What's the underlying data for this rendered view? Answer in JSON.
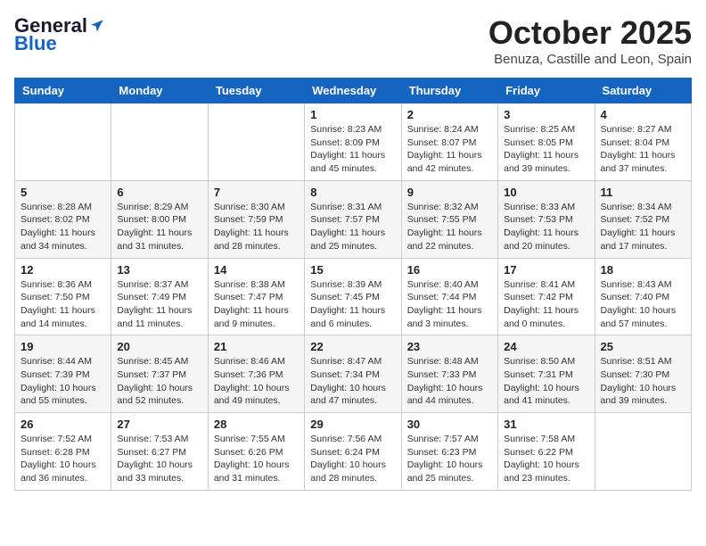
{
  "header": {
    "logo": {
      "general": "General",
      "blue": "Blue"
    },
    "title": "October 2025",
    "subtitle": "Benuza, Castille and Leon, Spain"
  },
  "weekdays": [
    "Sunday",
    "Monday",
    "Tuesday",
    "Wednesday",
    "Thursday",
    "Friday",
    "Saturday"
  ],
  "weeks": [
    [
      {
        "day": "",
        "info": ""
      },
      {
        "day": "",
        "info": ""
      },
      {
        "day": "",
        "info": ""
      },
      {
        "day": "1",
        "info": "Sunrise: 8:23 AM\nSunset: 8:09 PM\nDaylight: 11 hours and 45 minutes."
      },
      {
        "day": "2",
        "info": "Sunrise: 8:24 AM\nSunset: 8:07 PM\nDaylight: 11 hours and 42 minutes."
      },
      {
        "day": "3",
        "info": "Sunrise: 8:25 AM\nSunset: 8:05 PM\nDaylight: 11 hours and 39 minutes."
      },
      {
        "day": "4",
        "info": "Sunrise: 8:27 AM\nSunset: 8:04 PM\nDaylight: 11 hours and 37 minutes."
      }
    ],
    [
      {
        "day": "5",
        "info": "Sunrise: 8:28 AM\nSunset: 8:02 PM\nDaylight: 11 hours and 34 minutes."
      },
      {
        "day": "6",
        "info": "Sunrise: 8:29 AM\nSunset: 8:00 PM\nDaylight: 11 hours and 31 minutes."
      },
      {
        "day": "7",
        "info": "Sunrise: 8:30 AM\nSunset: 7:59 PM\nDaylight: 11 hours and 28 minutes."
      },
      {
        "day": "8",
        "info": "Sunrise: 8:31 AM\nSunset: 7:57 PM\nDaylight: 11 hours and 25 minutes."
      },
      {
        "day": "9",
        "info": "Sunrise: 8:32 AM\nSunset: 7:55 PM\nDaylight: 11 hours and 22 minutes."
      },
      {
        "day": "10",
        "info": "Sunrise: 8:33 AM\nSunset: 7:53 PM\nDaylight: 11 hours and 20 minutes."
      },
      {
        "day": "11",
        "info": "Sunrise: 8:34 AM\nSunset: 7:52 PM\nDaylight: 11 hours and 17 minutes."
      }
    ],
    [
      {
        "day": "12",
        "info": "Sunrise: 8:36 AM\nSunset: 7:50 PM\nDaylight: 11 hours and 14 minutes."
      },
      {
        "day": "13",
        "info": "Sunrise: 8:37 AM\nSunset: 7:49 PM\nDaylight: 11 hours and 11 minutes."
      },
      {
        "day": "14",
        "info": "Sunrise: 8:38 AM\nSunset: 7:47 PM\nDaylight: 11 hours and 9 minutes."
      },
      {
        "day": "15",
        "info": "Sunrise: 8:39 AM\nSunset: 7:45 PM\nDaylight: 11 hours and 6 minutes."
      },
      {
        "day": "16",
        "info": "Sunrise: 8:40 AM\nSunset: 7:44 PM\nDaylight: 11 hours and 3 minutes."
      },
      {
        "day": "17",
        "info": "Sunrise: 8:41 AM\nSunset: 7:42 PM\nDaylight: 11 hours and 0 minutes."
      },
      {
        "day": "18",
        "info": "Sunrise: 8:43 AM\nSunset: 7:40 PM\nDaylight: 10 hours and 57 minutes."
      }
    ],
    [
      {
        "day": "19",
        "info": "Sunrise: 8:44 AM\nSunset: 7:39 PM\nDaylight: 10 hours and 55 minutes."
      },
      {
        "day": "20",
        "info": "Sunrise: 8:45 AM\nSunset: 7:37 PM\nDaylight: 10 hours and 52 minutes."
      },
      {
        "day": "21",
        "info": "Sunrise: 8:46 AM\nSunset: 7:36 PM\nDaylight: 10 hours and 49 minutes."
      },
      {
        "day": "22",
        "info": "Sunrise: 8:47 AM\nSunset: 7:34 PM\nDaylight: 10 hours and 47 minutes."
      },
      {
        "day": "23",
        "info": "Sunrise: 8:48 AM\nSunset: 7:33 PM\nDaylight: 10 hours and 44 minutes."
      },
      {
        "day": "24",
        "info": "Sunrise: 8:50 AM\nSunset: 7:31 PM\nDaylight: 10 hours and 41 minutes."
      },
      {
        "day": "25",
        "info": "Sunrise: 8:51 AM\nSunset: 7:30 PM\nDaylight: 10 hours and 39 minutes."
      }
    ],
    [
      {
        "day": "26",
        "info": "Sunrise: 7:52 AM\nSunset: 6:28 PM\nDaylight: 10 hours and 36 minutes."
      },
      {
        "day": "27",
        "info": "Sunrise: 7:53 AM\nSunset: 6:27 PM\nDaylight: 10 hours and 33 minutes."
      },
      {
        "day": "28",
        "info": "Sunrise: 7:55 AM\nSunset: 6:26 PM\nDaylight: 10 hours and 31 minutes."
      },
      {
        "day": "29",
        "info": "Sunrise: 7:56 AM\nSunset: 6:24 PM\nDaylight: 10 hours and 28 minutes."
      },
      {
        "day": "30",
        "info": "Sunrise: 7:57 AM\nSunset: 6:23 PM\nDaylight: 10 hours and 25 minutes."
      },
      {
        "day": "31",
        "info": "Sunrise: 7:58 AM\nSunset: 6:22 PM\nDaylight: 10 hours and 23 minutes."
      },
      {
        "day": "",
        "info": ""
      }
    ]
  ]
}
